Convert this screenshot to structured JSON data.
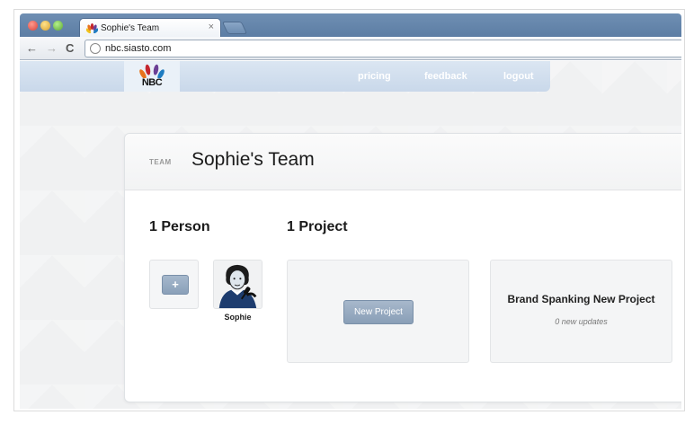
{
  "browser": {
    "tab_title": "Sophie's Team",
    "tab_close": "×",
    "url": "nbc.siasto.com",
    "nav": {
      "back": "←",
      "forward": "→",
      "reload": "C"
    }
  },
  "site": {
    "logo_text": "NBC",
    "nav_links": [
      "pricing",
      "feedback",
      "logout"
    ]
  },
  "team": {
    "label": "TEAM",
    "name": "Sophie's Team",
    "people_heading": "1 Person",
    "projects_heading": "1 Project",
    "add_member_label": "+",
    "members": [
      {
        "name": "Sophie"
      }
    ],
    "new_project_label": "New Project",
    "projects": [
      {
        "name": "Brand Spanking New Project",
        "meta": "0 new updates"
      }
    ]
  },
  "colors": {
    "nav_bar": "#c9d8ea",
    "button": "#8aa0b9",
    "peacock": [
      "#f0c21a",
      "#e8731d",
      "#c4262e",
      "#6b3f95",
      "#1f7cc1",
      "#3aa241"
    ]
  },
  "icons": [
    "peacock-logo-icon",
    "close-icon",
    "back-arrow-icon",
    "forward-arrow-icon",
    "reload-icon",
    "globe-icon",
    "plus-icon"
  ]
}
